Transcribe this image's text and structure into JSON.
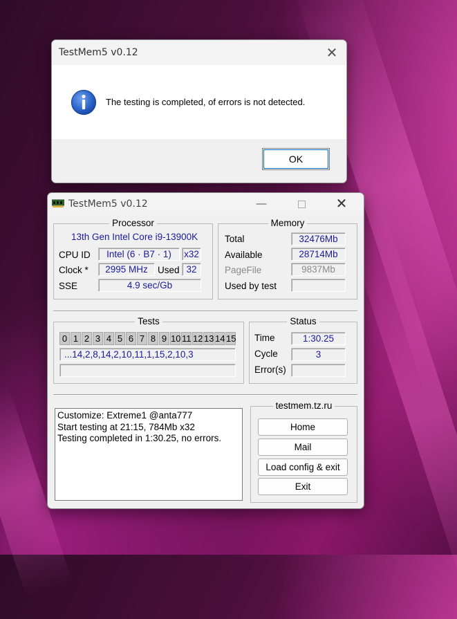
{
  "dialog": {
    "title": "TestMem5 v0.12",
    "message": "The testing is completed, of errors is not detected.",
    "ok_label": "OK",
    "close_glyph": "✕",
    "icon": "info-icon"
  },
  "window": {
    "title": "TestMem5 v0.12",
    "min_glyph": "—",
    "close_glyph": "✕",
    "icon": "memory-chip-icon"
  },
  "processor": {
    "heading": "Processor",
    "name": "13th Gen Intel Core i9-13900K",
    "cpuid_label": "CPU ID",
    "cpuid_value": "Intel  (6 · B7 · 1)",
    "arch_value": "x32",
    "clock_label": "Clock *",
    "clock_value": "2995 MHz",
    "used_label": "Used",
    "used_value": "32",
    "sse_label": "SSE",
    "sse_value": "4.9 sec/Gb"
  },
  "memory": {
    "heading": "Memory",
    "total_label": "Total",
    "total_value": "32476Mb",
    "available_label": "Available",
    "available_value": "28714Mb",
    "pagefile_label": "PageFile",
    "pagefile_value": "9837Mb",
    "usedbytest_label": "Used by test",
    "usedbytest_value": ""
  },
  "tests": {
    "heading": "Tests",
    "cells": [
      "0",
      "1",
      "2",
      "3",
      "4",
      "5",
      "6",
      "7",
      "8",
      "9",
      "10",
      "11",
      "12",
      "13",
      "14",
      "15"
    ],
    "sequence": "...14,2,8,14,2,10,11,1,15,2,10,3",
    "progress_text": ""
  },
  "status": {
    "heading": "Status",
    "time_label": "Time",
    "time_value": "1:30.25",
    "cycle_label": "Cycle",
    "cycle_value": "3",
    "errors_label": "Error(s)",
    "errors_value": ""
  },
  "log": {
    "lines": [
      "Customize: Extreme1 @anta777",
      "Start testing at 21:15, 784Mb x32",
      "Testing completed in 1:30.25, no errors."
    ]
  },
  "links": {
    "site": "testmem.tz.ru",
    "home_label": "Home",
    "mail_label": "Mail",
    "load_label": "Load config & exit",
    "exit_label": "Exit"
  },
  "colors": {
    "value_text": "#1a1a9a",
    "info_icon": "#2b63c9",
    "focus_ring": "#0067c0"
  }
}
